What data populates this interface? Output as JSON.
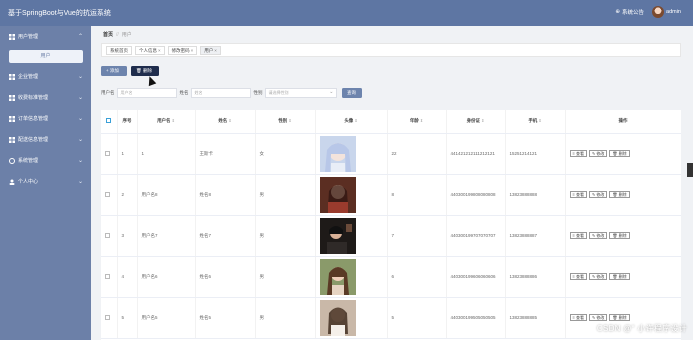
{
  "app": {
    "title": "基于SpringBoot与Vue的抗运系统",
    "notice_label": "系统公告",
    "user": "admin"
  },
  "sidebar": {
    "items": [
      {
        "label": "用户管理",
        "expanded": true,
        "sub": [
          "用户"
        ]
      },
      {
        "label": "企业管理"
      },
      {
        "label": "收费标准管理"
      },
      {
        "label": "订单信息管理"
      },
      {
        "label": "配送信息管理"
      },
      {
        "label": "系统管理"
      },
      {
        "label": "个人中心"
      }
    ]
  },
  "breadcrumb": {
    "home": "首页",
    "sep": "//",
    "current": "用户"
  },
  "tabs": [
    {
      "label": "系统首页",
      "closable": false
    },
    {
      "label": "个人信息",
      "closable": true
    },
    {
      "label": "修改密码",
      "closable": true
    },
    {
      "label": "用户",
      "closable": true,
      "active": true
    }
  ],
  "toolbar": {
    "add_label": "+ 添加",
    "delete_label": "🗑 删除"
  },
  "search": {
    "username_label": "用户名",
    "username_placeholder": "用户名",
    "name_label": "姓名",
    "name_placeholder": "姓名",
    "gender_label": "性别",
    "gender_placeholder": "请选择性别",
    "query_label": "查询"
  },
  "table": {
    "headers": [
      "序号",
      "用户名",
      "姓名",
      "性别",
      "头像",
      "年龄",
      "身份证",
      "手机",
      "操作"
    ],
    "rows": [
      {
        "index": "1",
        "username": "1",
        "name": "王斯卡",
        "gender": "女",
        "age": "22",
        "idcard": "441421212111212121",
        "phone": "15251214121"
      },
      {
        "index": "2",
        "username": "用户名8",
        "name": "姓名8",
        "gender": "男",
        "age": "8",
        "idcard": "440300199808080808",
        "phone": "13823888888"
      },
      {
        "index": "3",
        "username": "用户名7",
        "name": "姓名7",
        "gender": "男",
        "age": "7",
        "idcard": "440300199707070707",
        "phone": "13823888887"
      },
      {
        "index": "4",
        "username": "用户名6",
        "name": "姓名6",
        "gender": "男",
        "age": "6",
        "idcard": "440300199606060606",
        "phone": "13823888886"
      },
      {
        "index": "5",
        "username": "用户名5",
        "name": "姓名5",
        "gender": "男",
        "age": "5",
        "idcard": "440300199505050505",
        "phone": "13823888885"
      }
    ],
    "actions": {
      "view": "≡ 查看",
      "edit": "✎ 修改",
      "delete": "🗑 删除"
    }
  },
  "watermark": "CSDN @“ 小许程序设计",
  "colors": {
    "topbar": "#5e76a3",
    "sidebar": "#6c80a8",
    "primary_btn": "#6d84ad",
    "delete_btn": "#1f2d4d"
  }
}
